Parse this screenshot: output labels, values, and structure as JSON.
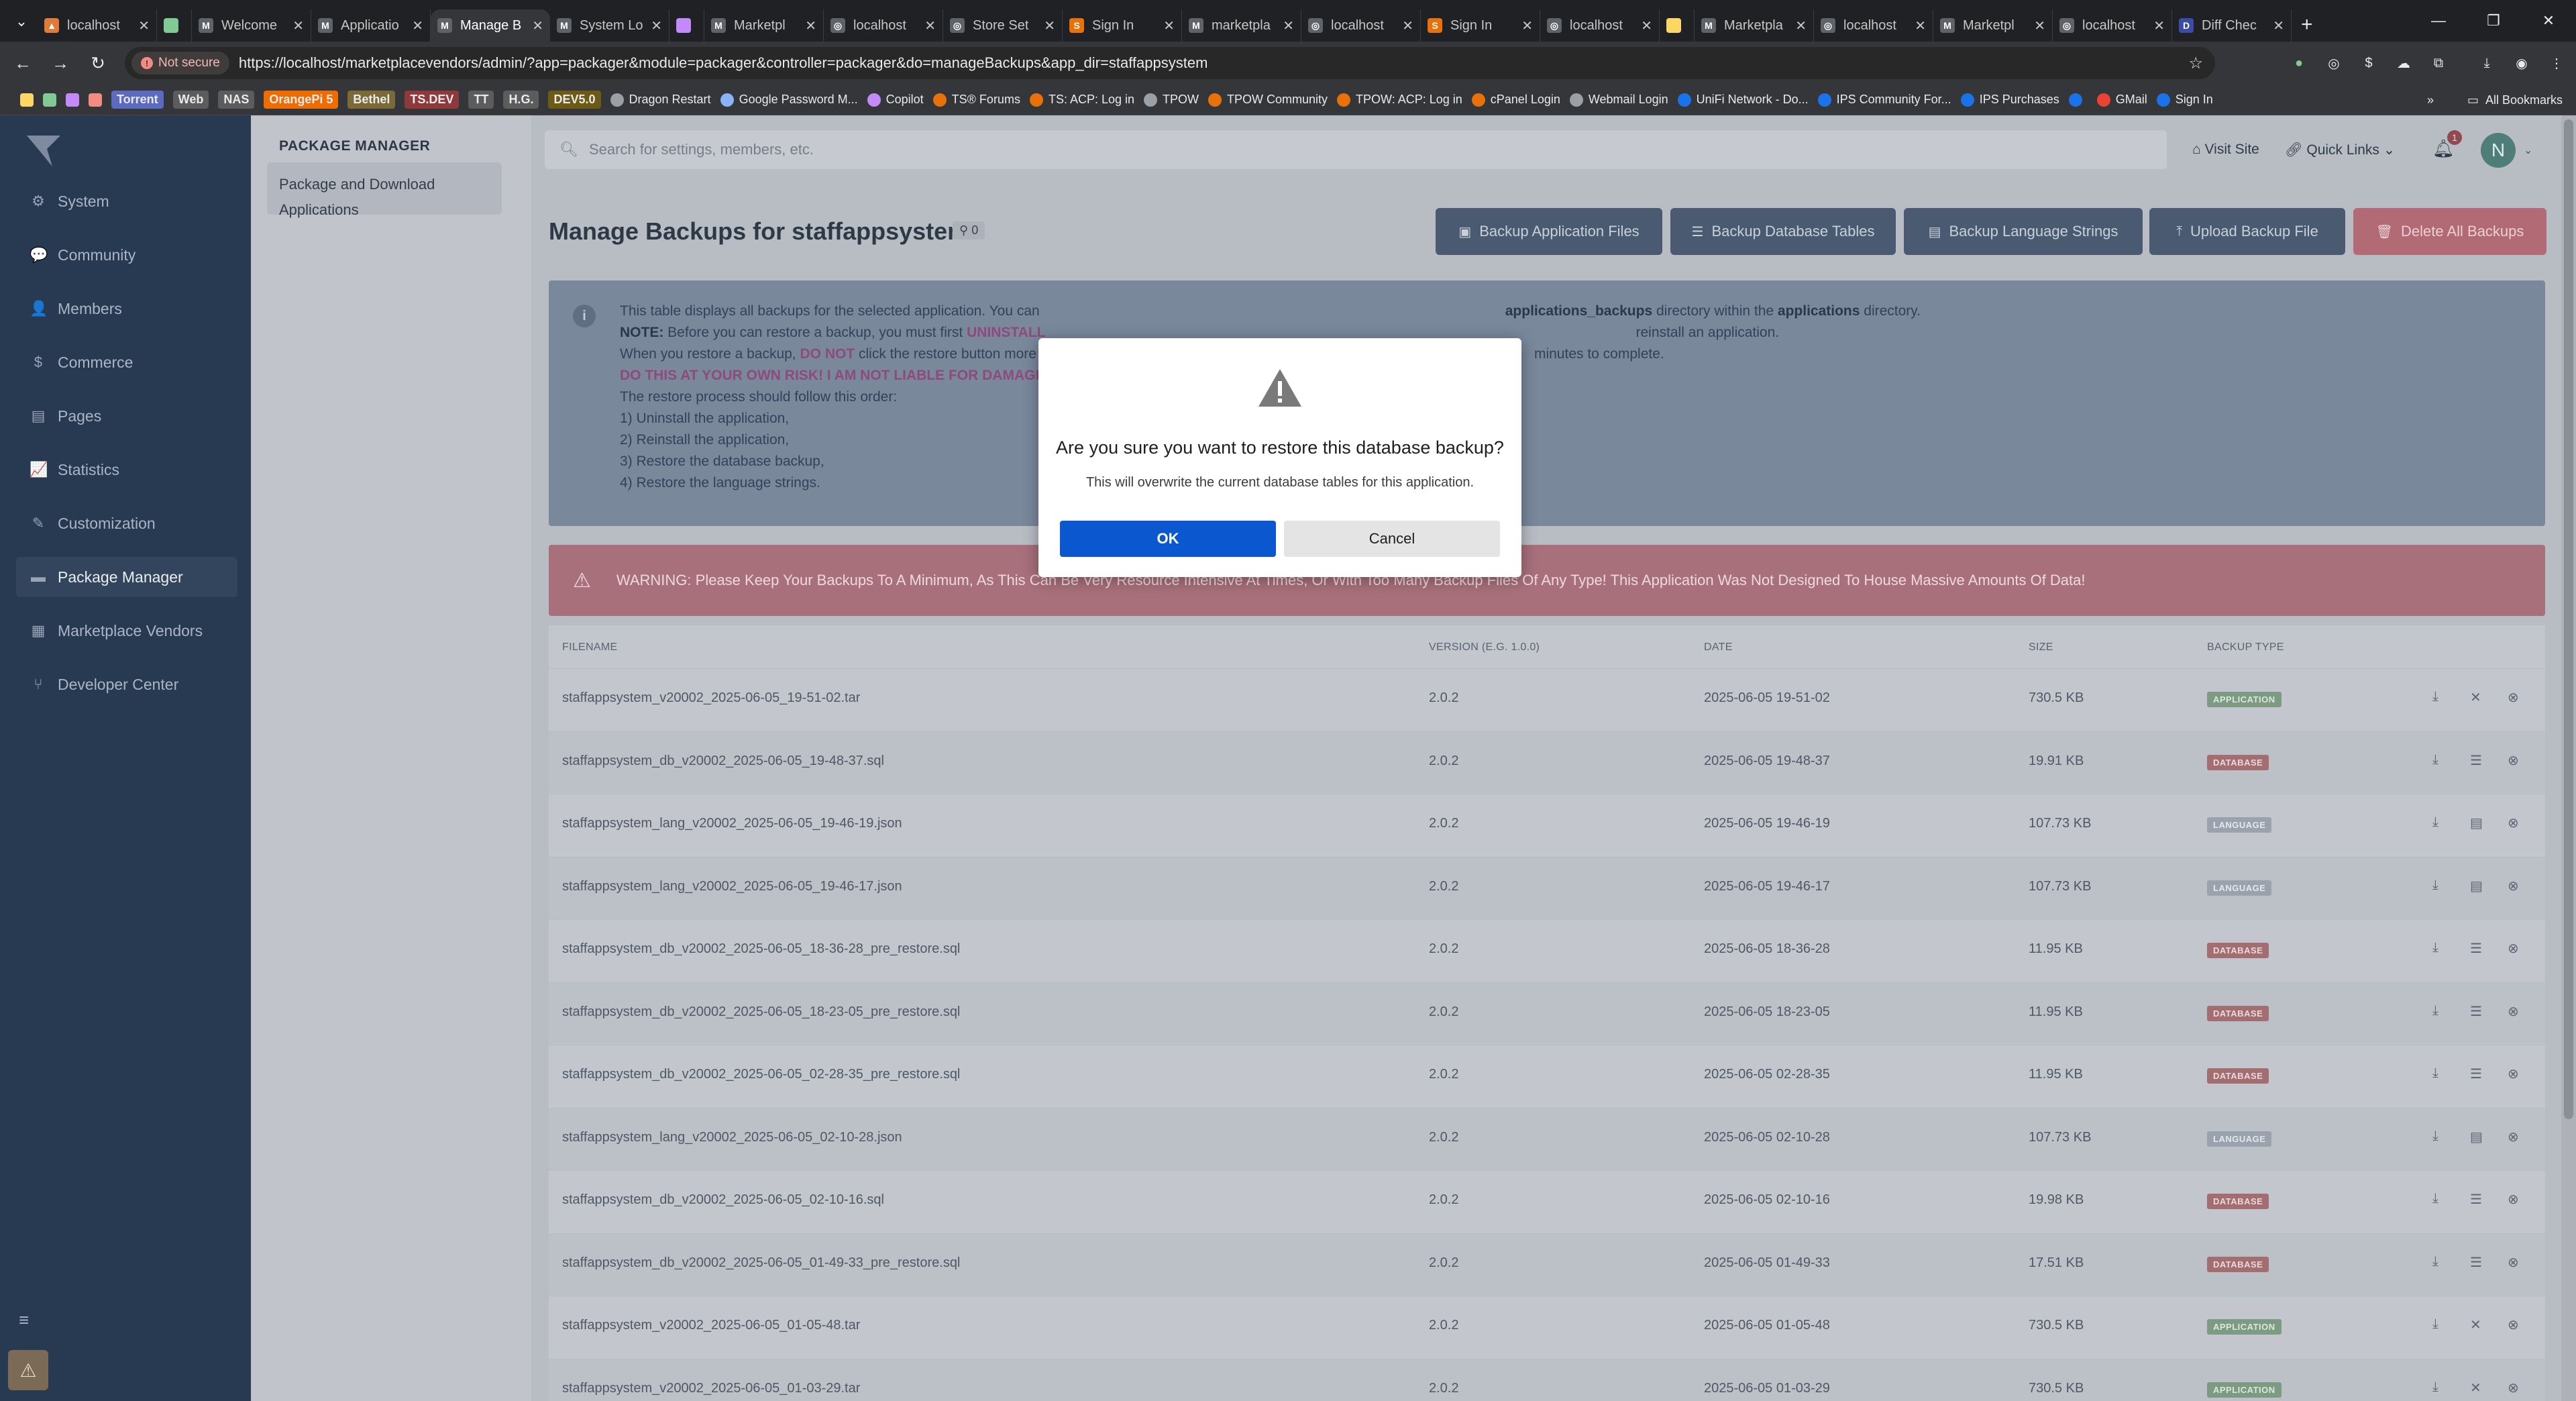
{
  "browser": {
    "tabs": [
      {
        "title": "localhost",
        "favicon": "#e07b39",
        "glyph": "▲"
      },
      {
        "title": "",
        "favicon": "#81c995",
        "glyph": ""
      },
      {
        "title": "Welcome",
        "favicon": "#5f6368",
        "glyph": "M"
      },
      {
        "title": "Applicatio",
        "favicon": "#5f6368",
        "glyph": "M"
      },
      {
        "title": "Manage B",
        "favicon": "#5f6368",
        "glyph": "M",
        "active": true
      },
      {
        "title": "System Lo",
        "favicon": "#5f6368",
        "glyph": "M"
      },
      {
        "title": "",
        "favicon": "#c58af9",
        "glyph": ""
      },
      {
        "title": "Marketpl",
        "favicon": "#5f6368",
        "glyph": "M"
      },
      {
        "title": "localhost",
        "favicon": "#5f6368",
        "glyph": "◎"
      },
      {
        "title": "Store Set",
        "favicon": "#5f6368",
        "glyph": "◎"
      },
      {
        "title": "Sign In",
        "favicon": "#e8710a",
        "glyph": "S"
      },
      {
        "title": "marketpla",
        "favicon": "#5f6368",
        "glyph": "M"
      },
      {
        "title": "localhost",
        "favicon": "#5f6368",
        "glyph": "◎"
      },
      {
        "title": "Sign In",
        "favicon": "#e8710a",
        "glyph": "S"
      },
      {
        "title": "localhost",
        "favicon": "#5f6368",
        "glyph": "◎"
      },
      {
        "title": "",
        "favicon": "#fdd663",
        "glyph": ""
      },
      {
        "title": "Marketpla",
        "favicon": "#5f6368",
        "glyph": "M"
      },
      {
        "title": "localhost",
        "favicon": "#5f6368",
        "glyph": "◎"
      },
      {
        "title": "Marketpl",
        "favicon": "#5f6368",
        "glyph": "M"
      },
      {
        "title": "localhost",
        "favicon": "#5f6368",
        "glyph": "◎"
      },
      {
        "title": "Diff Chec",
        "favicon": "#3c4ba8",
        "glyph": "D"
      }
    ],
    "not_secure": "Not secure",
    "url": "https://localhost/marketplacevendors/admin/?app=packager&module=packager&controller=packager&do=manageBackups&app_dir=staffappsystem",
    "bookmarks": [
      {
        "label": "Torrent",
        "kind": "tag",
        "color": "#5c6bc0"
      },
      {
        "label": "Web",
        "kind": "tag",
        "color": "#5c5c5c"
      },
      {
        "label": "NAS",
        "kind": "tag",
        "color": "#5c5c5c"
      },
      {
        "label": "OrangePi 5",
        "kind": "tag",
        "color": "#ef6c00"
      },
      {
        "label": "Bethel",
        "kind": "tag",
        "color": "#7b6a35"
      },
      {
        "label": "TS.DEV",
        "kind": "tag",
        "color": "#8e3a3a"
      },
      {
        "label": "TT",
        "kind": "tag",
        "color": "#5c5c5c"
      },
      {
        "label": "H.G.",
        "kind": "tag",
        "color": "#5c5c5c"
      },
      {
        "label": "DEV5.0",
        "kind": "tag",
        "color": "#6d5a14"
      },
      {
        "label": "Dragon Restart",
        "kind": "link",
        "color": "#9aa0a6"
      },
      {
        "label": "Google Password M...",
        "kind": "link",
        "color": "#8ab4f8"
      },
      {
        "label": "Copilot",
        "kind": "link",
        "color": "#c58af9"
      },
      {
        "label": "TS® Forums",
        "kind": "link",
        "color": "#e8710a"
      },
      {
        "label": "TS: ACP: Log in",
        "kind": "link",
        "color": "#e8710a"
      },
      {
        "label": "TPOW",
        "kind": "link",
        "color": "#9aa0a6"
      },
      {
        "label": "TPOW Community",
        "kind": "link",
        "color": "#e8710a"
      },
      {
        "label": "TPOW: ACP: Log in",
        "kind": "link",
        "color": "#e8710a"
      },
      {
        "label": "cPanel Login",
        "kind": "link",
        "color": "#e8710a"
      },
      {
        "label": "Webmail Login",
        "kind": "link",
        "color": "#9aa0a6"
      },
      {
        "label": "UniFi Network - Do...",
        "kind": "link",
        "color": "#1a73e8"
      },
      {
        "label": "IPS Community For...",
        "kind": "link",
        "color": "#1a73e8"
      },
      {
        "label": "IPS Purchases",
        "kind": "link",
        "color": "#1a73e8"
      },
      {
        "label": "",
        "kind": "link",
        "color": "#1a73e8"
      },
      {
        "label": "GMail",
        "kind": "link",
        "color": "#ea4335"
      },
      {
        "label": "Sign In",
        "kind": "link",
        "color": "#1a73e8"
      }
    ],
    "all_bookmarks": "All Bookmarks"
  },
  "sidebar": {
    "items": [
      {
        "label": "System",
        "icon": "gear-icon",
        "glyph": "⚙"
      },
      {
        "label": "Community",
        "icon": "chat-icon",
        "glyph": "💬"
      },
      {
        "label": "Members",
        "icon": "user-icon",
        "glyph": "👤"
      },
      {
        "label": "Commerce",
        "icon": "dollar-icon",
        "glyph": "$"
      },
      {
        "label": "Pages",
        "icon": "page-icon",
        "glyph": "▤"
      },
      {
        "label": "Statistics",
        "icon": "chart-icon",
        "glyph": "📈"
      },
      {
        "label": "Customization",
        "icon": "brush-icon",
        "glyph": "✎"
      },
      {
        "label": "Package Manager",
        "icon": "package-icon",
        "glyph": "▬",
        "active": true
      },
      {
        "label": "Marketplace Vendors",
        "icon": "store-icon",
        "glyph": "▦"
      },
      {
        "label": "Developer Center",
        "icon": "code-icon",
        "glyph": "⑂"
      }
    ]
  },
  "subnav": {
    "heading": "PACKAGE MANAGER",
    "item": "Package and Download Applications"
  },
  "header": {
    "search_placeholder": "Search for settings, members, etc.",
    "visit_site": "Visit Site",
    "quick_links": "Quick Links",
    "notification_count": "1",
    "avatar_letter": "N"
  },
  "main": {
    "title": "Manage Backups for staffappsystem",
    "title_badge": "0",
    "buttons": {
      "backup_app": "Backup Application Files",
      "backup_db": "Backup Database Tables",
      "backup_lang": "Backup Language Strings",
      "upload": "Upload Backup File",
      "delete_all": "Delete All Backups"
    },
    "info": {
      "line1a": "This table displays all backups for the selected application. You can",
      "line1b": "applications_backups",
      "line1c": "directory within the",
      "line1d": "applications",
      "line1e": "directory.",
      "line2a": "NOTE:",
      "line2b": "Before you can restore a backup, you must first",
      "line2c": "UNINSTALL",
      "line2d": "reinstall an application.",
      "line3a": "When you restore a backup,",
      "line3b": "DO NOT",
      "line3c": "click the restore button more",
      "line3d": "minutes to complete.",
      "line4": "DO THIS AT YOUR OWN RISK! I AM NOT LIABLE FOR DAMAGE",
      "line5": "The restore process should follow this order:",
      "step1": "1) Uninstall the application,",
      "step2": "2) Reinstall the application,",
      "step3": "3) Restore the database backup,",
      "step4": "4) Restore the language strings."
    },
    "warning": "WARNING: Please Keep Your Backups To A Minimum, As This Can Be Very Resource Intensive At Times, Or With Too Many Backup Files Of Any Type! This Application Was Not Designed To House Massive Amounts Of Data!",
    "table": {
      "headers": {
        "filename": "FILENAME",
        "version": "VERSION (E.G. 1.0.0)",
        "date": "DATE",
        "size": "SIZE",
        "type": "BACKUP TYPE"
      },
      "rows": [
        {
          "filename": "staffappsystem_v20002_2025-06-05_19-51-02.tar",
          "version": "2.0.2",
          "date": "2025-06-05 19-51-02",
          "size": "730.5 KB",
          "type": "APPLICATION",
          "kind": "app"
        },
        {
          "filename": "staffappsystem_db_v20002_2025-06-05_19-48-37.sql",
          "version": "2.0.2",
          "date": "2025-06-05 19-48-37",
          "size": "19.91 KB",
          "type": "DATABASE",
          "kind": "db"
        },
        {
          "filename": "staffappsystem_lang_v20002_2025-06-05_19-46-19.json",
          "version": "2.0.2",
          "date": "2025-06-05 19-46-19",
          "size": "107.73 KB",
          "type": "LANGUAGE",
          "kind": "lang"
        },
        {
          "filename": "staffappsystem_lang_v20002_2025-06-05_19-46-17.json",
          "version": "2.0.2",
          "date": "2025-06-05 19-46-17",
          "size": "107.73 KB",
          "type": "LANGUAGE",
          "kind": "lang"
        },
        {
          "filename": "staffappsystem_db_v20002_2025-06-05_18-36-28_pre_restore.sql",
          "version": "2.0.2",
          "date": "2025-06-05 18-36-28",
          "size": "11.95 KB",
          "type": "DATABASE",
          "kind": "db"
        },
        {
          "filename": "staffappsystem_db_v20002_2025-06-05_18-23-05_pre_restore.sql",
          "version": "2.0.2",
          "date": "2025-06-05 18-23-05",
          "size": "11.95 KB",
          "type": "DATABASE",
          "kind": "db"
        },
        {
          "filename": "staffappsystem_db_v20002_2025-06-05_02-28-35_pre_restore.sql",
          "version": "2.0.2",
          "date": "2025-06-05 02-28-35",
          "size": "11.95 KB",
          "type": "DATABASE",
          "kind": "db"
        },
        {
          "filename": "staffappsystem_lang_v20002_2025-06-05_02-10-28.json",
          "version": "2.0.2",
          "date": "2025-06-05 02-10-28",
          "size": "107.73 KB",
          "type": "LANGUAGE",
          "kind": "lang"
        },
        {
          "filename": "staffappsystem_db_v20002_2025-06-05_02-10-16.sql",
          "version": "2.0.2",
          "date": "2025-06-05 02-10-16",
          "size": "19.98 KB",
          "type": "DATABASE",
          "kind": "db"
        },
        {
          "filename": "staffappsystem_db_v20002_2025-06-05_01-49-33_pre_restore.sql",
          "version": "2.0.2",
          "date": "2025-06-05 01-49-33",
          "size": "17.51 KB",
          "type": "DATABASE",
          "kind": "db"
        },
        {
          "filename": "staffappsystem_v20002_2025-06-05_01-05-48.tar",
          "version": "2.0.2",
          "date": "2025-06-05 01-05-48",
          "size": "730.5 KB",
          "type": "APPLICATION",
          "kind": "app"
        },
        {
          "filename": "staffappsystem_v20002_2025-06-05_01-03-29.tar",
          "version": "2.0.2",
          "date": "2025-06-05 01-03-29",
          "size": "730.5 KB",
          "type": "APPLICATION",
          "kind": "app"
        }
      ]
    }
  },
  "dialog": {
    "title": "Are you sure you want to restore this database backup?",
    "message": "This will overwrite the current database tables for this application.",
    "ok": "OK",
    "cancel": "Cancel"
  }
}
